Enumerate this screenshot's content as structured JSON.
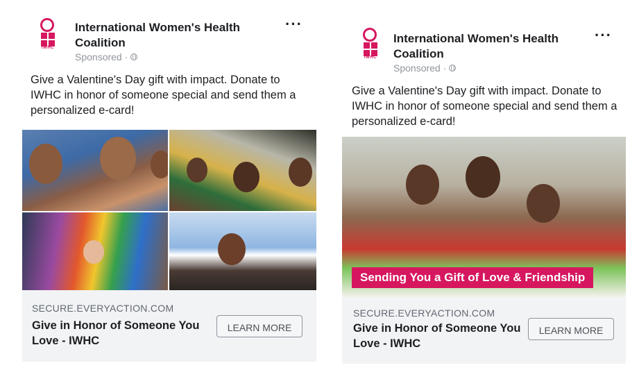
{
  "ads": [
    {
      "org_name": "International Women's Health Coalition",
      "logo_text": "IWHC",
      "sponsored": "Sponsored ·",
      "more_options": "···",
      "body": "Give a Valentine's Day gift with impact. Donate to IWHC in honor of someone special and send them a personalized e-card!",
      "domain": "SECURE.EVERYACTION.COM",
      "headline": "Give in Honor of Someone You Love - IWHC",
      "cta_label": "LEARN MORE"
    },
    {
      "org_name": "International Women's Health Coalition",
      "logo_text": "IWHC",
      "sponsored": "Sponsored ·",
      "more_options": "···",
      "body": "Give a Valentine's Day gift with impact. Donate to IWHC in honor of someone special and send them a personalized e-card!",
      "banner_text": "Sending You a Gift of Love & Friendship",
      "domain": "SECURE.EVERYACTION.COM",
      "headline": "Give in Honor of Someone You Love - IWHC",
      "cta_label": "LEARN MORE"
    }
  ],
  "colors": {
    "brand": "#d6175f",
    "cta_bg": "#f2f3f5",
    "muted_text": "#90949c"
  }
}
